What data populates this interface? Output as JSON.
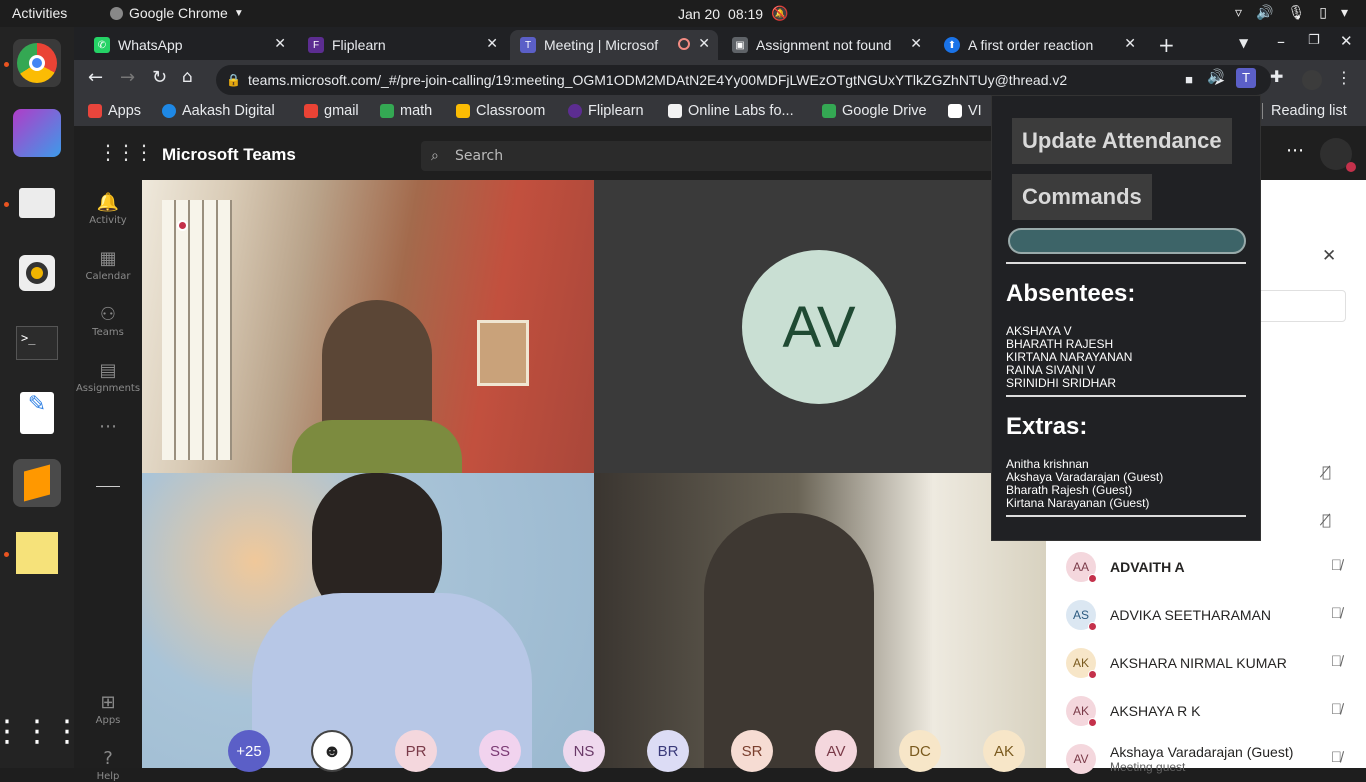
{
  "system": {
    "activities": "Activities",
    "app": "Google Chrome",
    "date": "Jan 20",
    "time": "08:19"
  },
  "tabs": [
    {
      "label": "WhatsApp",
      "color": "#25d366",
      "glyph": "✆"
    },
    {
      "label": "Fliplearn",
      "color": "#5c2d91",
      "glyph": "F"
    },
    {
      "label": "Meeting | Microsof",
      "color": "#5b5fc7",
      "glyph": "T"
    },
    {
      "label": "Assignment not found",
      "color": "#5f6368",
      "glyph": "▣"
    },
    {
      "label": "A first order reaction",
      "color": "#1a73e8",
      "glyph": "⬆"
    }
  ],
  "url": "teams.microsoft.com/_#/pre-join-calling/19:meeting_OGM1ODM2MDAtN2E4Yy00MDFjLWEzOTgtNGUxYTlkZGZhNTUy@thread.v2",
  "bookmarks": [
    {
      "label": "Apps",
      "color": "#e8453c"
    },
    {
      "label": "Aakash Digital",
      "color": "#1e88e5"
    },
    {
      "label": "gmail",
      "color": "#ea4335"
    },
    {
      "label": "math",
      "color": "#34a853"
    },
    {
      "label": "Classroom",
      "color": "#fbbc04"
    },
    {
      "label": "Fliplearn",
      "color": "#5c2d91"
    },
    {
      "label": "Online Labs fo...",
      "color": "#f2f2f2"
    },
    {
      "label": "Google Drive",
      "color": "#34a853"
    },
    {
      "label": "VI",
      "color": "#ffffff"
    }
  ],
  "reading_list": "Reading list",
  "teams": {
    "title": "Microsoft Teams",
    "search_placeholder": "Search"
  },
  "rail": [
    {
      "label": "Activity",
      "glyph": "🔔"
    },
    {
      "label": "Calendar",
      "glyph": "▦"
    },
    {
      "label": "Teams",
      "glyph": "⚇"
    },
    {
      "label": "Assignments",
      "glyph": "▤"
    },
    {
      "label": "Apps",
      "glyph": "⊞"
    },
    {
      "label": "Help",
      "glyph": "?"
    }
  ],
  "video": {
    "avatar_initials": "AV"
  },
  "chips": [
    {
      "label": "+25",
      "bg": "#5b5fc7",
      "fg": "#ffffff"
    },
    {
      "label": "",
      "bg": "#ffffff",
      "fg": "#000000"
    },
    {
      "label": "PR",
      "bg": "#f4d7dd",
      "fg": "#7a3a48"
    },
    {
      "label": "SS",
      "bg": "#f1d3ee",
      "fg": "#7b3a74"
    },
    {
      "label": "NS",
      "bg": "#efd9ee",
      "fg": "#6a3a68"
    },
    {
      "label": "BR",
      "bg": "#dcdcf5",
      "fg": "#3a3a7a"
    },
    {
      "label": "SR",
      "bg": "#f6dcd3",
      "fg": "#7a3f2e"
    },
    {
      "label": "AV",
      "bg": "#f4d7dd",
      "fg": "#7a3a48"
    },
    {
      "label": "DC",
      "bg": "#f7e6c8",
      "fg": "#7a5a1e"
    },
    {
      "label": "AK",
      "bg": "#f7e6c8",
      "fg": "#7a5a1e"
    }
  ],
  "participants": [
    {
      "initials": "AA",
      "name": "ADVAITH A",
      "sub": "",
      "bg": "#f4d7dd",
      "fg": "#7a3a48"
    },
    {
      "initials": "AS",
      "name": "ADVIKA SEETHARAMAN",
      "sub": "",
      "bg": "#dbe7f2",
      "fg": "#2b5a80"
    },
    {
      "initials": "AK",
      "name": "AKSHARA NIRMAL KUMAR",
      "sub": "",
      "bg": "#f7e6c8",
      "fg": "#7a5a1e"
    },
    {
      "initials": "AK",
      "name": "AKSHAYA R K",
      "sub": "",
      "bg": "#f4d7dd",
      "fg": "#7a3a48"
    },
    {
      "initials": "AV",
      "name": "Akshaya Varadarajan (Guest)",
      "sub": "Meeting guest",
      "bg": "#f4d7dd",
      "fg": "#7a3a48"
    }
  ],
  "extension": {
    "update_button": "Update Attendance",
    "commands_button": "Commands",
    "absentees_heading": "Absentees:",
    "absentees": [
      "AKSHAYA V",
      "BHARATH RAJESH",
      "KIRTANA NARAYANAN",
      "RAINA SIVANI V",
      "SRINIDHI SRIDHAR"
    ],
    "extras_heading": "Extras:",
    "extras": [
      "Anitha krishnan",
      "Akshaya Varadarajan (Guest)",
      "Bharath Rajesh (Guest)",
      "Kirtana Narayanan (Guest)"
    ]
  }
}
